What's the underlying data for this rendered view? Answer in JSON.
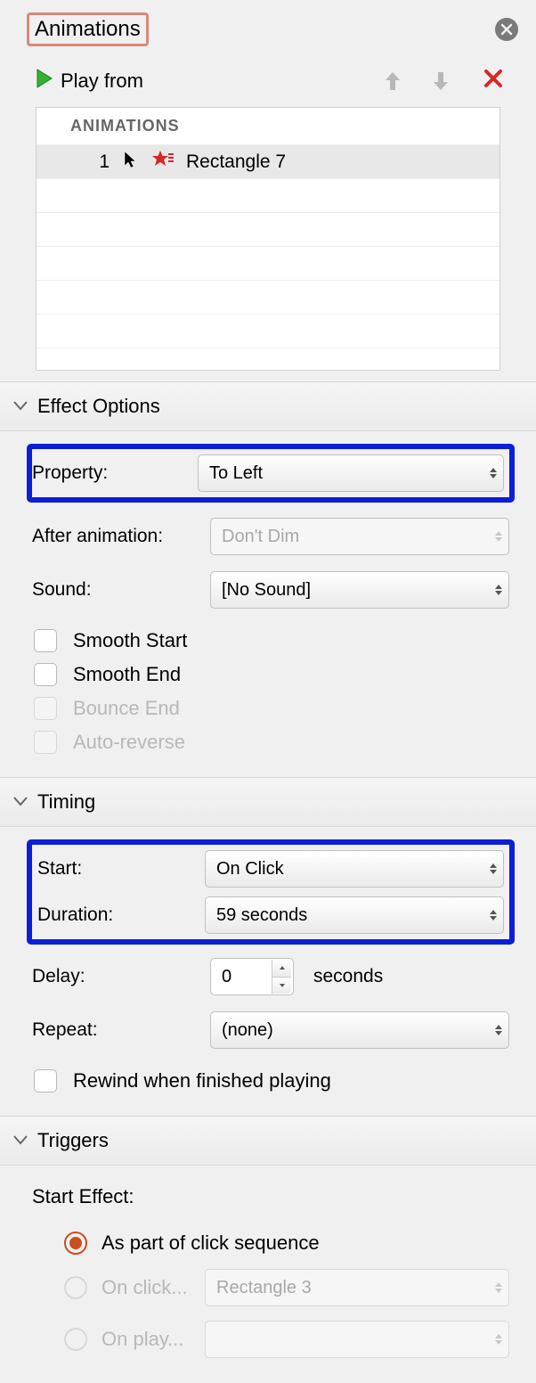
{
  "header": {
    "title": "Animations"
  },
  "playbar": {
    "play_label": "Play from"
  },
  "anim_list": {
    "header": "ANIMATIONS",
    "items": [
      {
        "index": "1",
        "name": "Rectangle 7"
      }
    ]
  },
  "effect_options": {
    "section_title": "Effect Options",
    "property_label": "Property:",
    "property_value": "To Left",
    "after_anim_label": "After animation:",
    "after_anim_value": "Don't Dim",
    "sound_label": "Sound:",
    "sound_value": "[No Sound]",
    "smooth_start": "Smooth Start",
    "smooth_end": "Smooth End",
    "bounce_end": "Bounce End",
    "auto_reverse": "Auto-reverse"
  },
  "timing": {
    "section_title": "Timing",
    "start_label": "Start:",
    "start_value": "On Click",
    "duration_label": "Duration:",
    "duration_value": "59 seconds",
    "delay_label": "Delay:",
    "delay_value": "0",
    "delay_suffix": "seconds",
    "repeat_label": "Repeat:",
    "repeat_value": "(none)",
    "rewind_label": "Rewind when finished playing"
  },
  "triggers": {
    "section_title": "Triggers",
    "start_effect_label": "Start Effect:",
    "as_part_label": "As part of click sequence",
    "on_click_label": "On click...",
    "on_click_value": "Rectangle 3",
    "on_play_label": "On play..."
  }
}
